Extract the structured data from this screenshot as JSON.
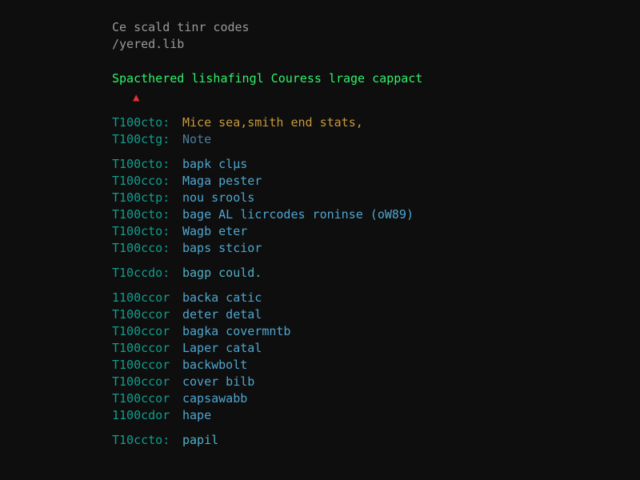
{
  "header": {
    "line1": "Ce scald tinr codes",
    "line2": "/yered.lib",
    "title": "Spacthered lishafingl Couress lrage cappact",
    "warn_glyph": "▲"
  },
  "groups": [
    [
      {
        "tag": "T100cto:",
        "val": "Mice sea,smith end stats,",
        "cls": "val-gold"
      },
      {
        "tag": "T100ctg:",
        "val": "Note",
        "cls": "val-dim"
      }
    ],
    [
      {
        "tag": "T100cto:",
        "val": "bapk clµs",
        "cls": "val"
      },
      {
        "tag": "T100cco:",
        "val": "Maga pester",
        "cls": "val"
      },
      {
        "tag": "T100ctp:",
        "val": "nou srools",
        "cls": "val"
      },
      {
        "tag": "T100cto:",
        "val": "bage AL licrcodes roninse (oW89)",
        "cls": "val"
      },
      {
        "tag": "T100cto:",
        "val": "Wagb eter",
        "cls": "val"
      },
      {
        "tag": "T100cco:",
        "val": "baps stcior",
        "cls": "val"
      }
    ],
    [
      {
        "tag": "T10ccdo:",
        "val": "bagp could.",
        "cls": "val-cyan"
      }
    ],
    [
      {
        "tag": "1100ccor",
        "val": "backa catic",
        "cls": "val"
      },
      {
        "tag": "T100ccor",
        "val": "deter detal",
        "cls": "val"
      },
      {
        "tag": "T100ccor",
        "val": "bagka covermntb",
        "cls": "val"
      },
      {
        "tag": "T100ccor",
        "val": "Laper catal",
        "cls": "val"
      },
      {
        "tag": "T100ccor",
        "val": "backwbolt",
        "cls": "val"
      },
      {
        "tag": "T100ccor",
        "val": "cover bilb",
        "cls": "val"
      },
      {
        "tag": "T100ccor",
        "val": "capsawabb",
        "cls": "val"
      },
      {
        "tag": "1100cdor",
        "val": "hape",
        "cls": "val"
      }
    ],
    [
      {
        "tag": "T10ccto:",
        "val": "papil",
        "cls": "val-cyan"
      }
    ]
  ]
}
